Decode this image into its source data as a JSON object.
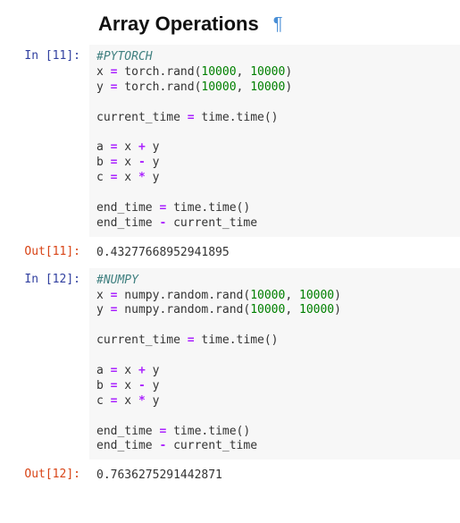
{
  "heading": "Array Operations",
  "pilcrow": "¶",
  "cells": [
    {
      "in_prompt": "In [11]:",
      "out_prompt": "Out[11]:",
      "comment": "#PYTORCH",
      "assign_x_prefix": "x ",
      "assign_x_call": " torch.rand(",
      "assign_y_prefix": "y ",
      "assign_y_call": " torch.rand(",
      "dim1": "10000",
      "dim_sep": ", ",
      "dim2": "10000",
      "close_paren": ")",
      "curtime_lhs": "current_time ",
      "curtime_rhs": " time.time()",
      "a_lhs": "a ",
      "b_lhs": "b ",
      "c_lhs": "c ",
      "xy_x": " x ",
      "xy_y": " y",
      "op_plus": "+",
      "op_minus": "-",
      "op_star": "*",
      "op_eq": "=",
      "end_lhs": "end_time ",
      "end_rhs": " time.time()",
      "diff_lhs": "end_time ",
      "diff_rhs": " current_time",
      "output": "0.43277668952941895"
    },
    {
      "in_prompt": "In [12]:",
      "out_prompt": "Out[12]:",
      "comment": "#NUMPY",
      "assign_x_prefix": "x ",
      "assign_x_call": " numpy.random.rand(",
      "assign_y_prefix": "y ",
      "assign_y_call": " numpy.random.rand(",
      "dim1": "10000",
      "dim_sep": ", ",
      "dim2": "10000",
      "close_paren": ")",
      "curtime_lhs": "current_time ",
      "curtime_rhs": " time.time()",
      "a_lhs": "a ",
      "b_lhs": "b ",
      "c_lhs": "c ",
      "xy_x": " x ",
      "xy_y": " y",
      "op_plus": "+",
      "op_minus": "-",
      "op_star": "*",
      "op_eq": "=",
      "end_lhs": "end_time ",
      "end_rhs": " time.time()",
      "diff_lhs": "end_time ",
      "diff_rhs": " current_time",
      "output": "0.7636275291442871"
    }
  ]
}
